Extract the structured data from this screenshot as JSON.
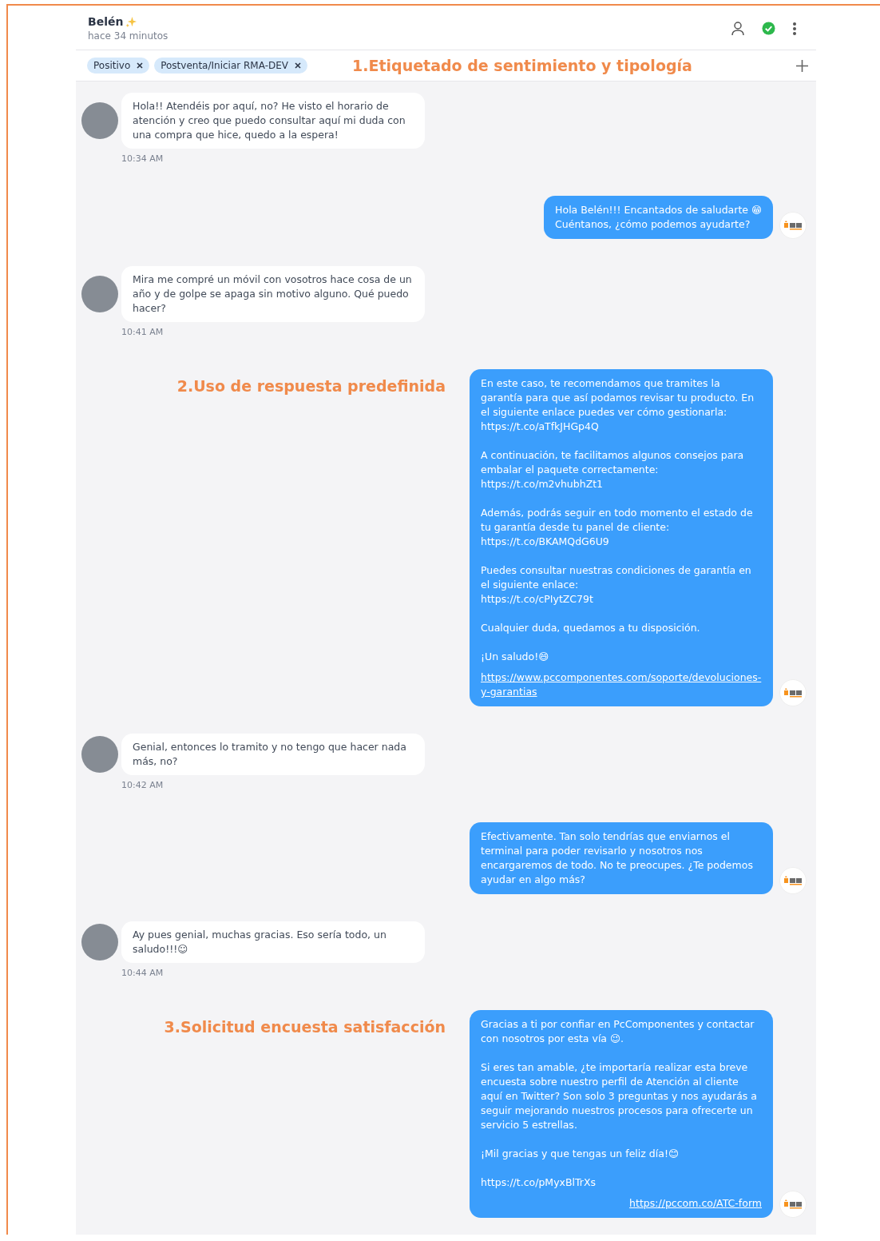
{
  "header": {
    "name": "Belén",
    "subtitle": "hace 34 minutos",
    "status_ok": true
  },
  "tags": [
    {
      "label": "Positivo"
    },
    {
      "label": "Postventa/Iniciar RMA-DEV"
    }
  ],
  "tags_annotation": "1.Etiquetado de sentimiento y tipología",
  "messages": [
    {
      "kind": "customer",
      "text": "Hola!! Atendéis por aquí, no? He visto el horario de atención y creo que puedo consultar aquí mi duda con una compra que hice, quedo a la espera!",
      "time": "10:34 AM"
    },
    {
      "kind": "agent",
      "paragraphs": [
        "Hola Belén!!! Encantados de saludarte 😁\nCuéntanos, ¿cómo podemos ayudarte?"
      ]
    },
    {
      "kind": "customer",
      "text": "Mira me compré un móvil con vosotros hace cosa de un año y de golpe se apaga sin motivo alguno. Qué puedo hacer?",
      "time": "10:41 AM"
    },
    {
      "kind": "agent",
      "annotation": "2.Uso de respuesta predefinida",
      "paragraphs": [
        "En este caso, te recomendamos que tramites la garantía para que así podamos revisar tu producto. En el siguiente enlace puedes ver cómo gestionarla:\nhttps://t.co/aTfkJHGp4Q",
        "A continuación, te facilitamos algunos consejos para embalar el paquete correctamente:\nhttps://t.co/m2vhubhZt1",
        "Además, podrás seguir en todo momento el estado de tu garantía desde tu panel de cliente:\nhttps://t.co/BKAMQdG6U9",
        "Puedes consultar nuestras condiciones de garantía en el siguiente enlace:\nhttps://t.co/cPIytZC79t",
        "Cualquier duda, quedamos a tu disposición.",
        "¡Un saludo!😄"
      ],
      "link": {
        "text": "https://www.pccomponentes.com/soporte/devoluciones-y-garantias",
        "right_aligned": false
      }
    },
    {
      "kind": "customer",
      "text": "Genial, entonces lo tramito y no tengo que hacer nada más, no?",
      "time": "10:42 AM"
    },
    {
      "kind": "agent",
      "paragraphs": [
        "Efectivamente. Tan solo tendrías que enviarnos el terminal para poder revisarlo y nosotros nos encargaremos de todo. No te preocupes. ¿Te podemos ayudar en algo más?"
      ]
    },
    {
      "kind": "customer",
      "text": "Ay pues genial, muchas gracias. Eso sería todo, un saludo!!!☺",
      "time": "10:44 AM"
    },
    {
      "kind": "agent",
      "annotation": "3.Solicitud  encuesta satisfacción",
      "paragraphs": [
        "Gracias a ti por confiar en PcComponentes y contactar con nosotros por esta vía 😉.",
        "Si eres tan amable, ¿te importaría realizar esta breve encuesta sobre nuestro perfil de Atención al cliente aquí en Twitter? Son solo 3 preguntas y nos ayudarás a seguir mejorando nuestros procesos para ofrecerte un servicio 5 estrellas.",
        "¡Mil gracias y que tengas un feliz día!😊",
        "https://t.co/pMyxBlTrXs"
      ],
      "link": {
        "text": "https://pccom.co/ATC-form",
        "right_aligned": true
      }
    }
  ]
}
